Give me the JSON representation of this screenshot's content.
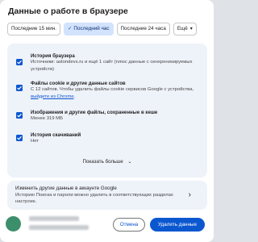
{
  "dialog": {
    "title": "Данные о работе в браузере"
  },
  "chips": [
    {
      "label": "Последние 15 мин.",
      "selected": false
    },
    {
      "label": "Последний час",
      "selected": true
    },
    {
      "label": "Последние 24 часа",
      "selected": false
    },
    {
      "label": "Ещё",
      "selected": false
    }
  ],
  "items": [
    {
      "title": "История браузера",
      "desc": "Источники: astondevs.ru и ещё 1 сайт (плюс данные с синхронизируемых устройств)",
      "checked": true
    },
    {
      "title": "Файлы cookie и другие данные сайтов",
      "desc": "С 12 сайтов. Чтобы удалить файлы cookie сервисов Google с устройства, ",
      "link": "выйдите из Chrome",
      "desc_end": ".",
      "checked": true
    },
    {
      "title": "Изображения и другие файлы, сохраненные в кеше",
      "desc": "Менее 319 МБ",
      "checked": true
    },
    {
      "title": "История скачиваний",
      "desc": "Нет",
      "checked": true
    }
  ],
  "show_more": "Показать больше",
  "google": {
    "title": "Изменить другие данные в аккаунте Google",
    "desc": "Историю Поиска и пароли можно удалить в соответствующих разделах настроек."
  },
  "footer": {
    "cancel_label": "Отмена",
    "delete_label": "Удалить данные"
  },
  "colors": {
    "accent": "#0b57d0",
    "panel_bg": "#eef2f9",
    "chip_selected_bg": "#d3e3fd"
  },
  "icons": {
    "chip_check": "check-icon",
    "chip_more": "chevron-down-icon",
    "checkbox": "checkbox-checked-icon",
    "show_more": "chevron-down-icon",
    "google_arrow": "chevron-right-icon"
  }
}
